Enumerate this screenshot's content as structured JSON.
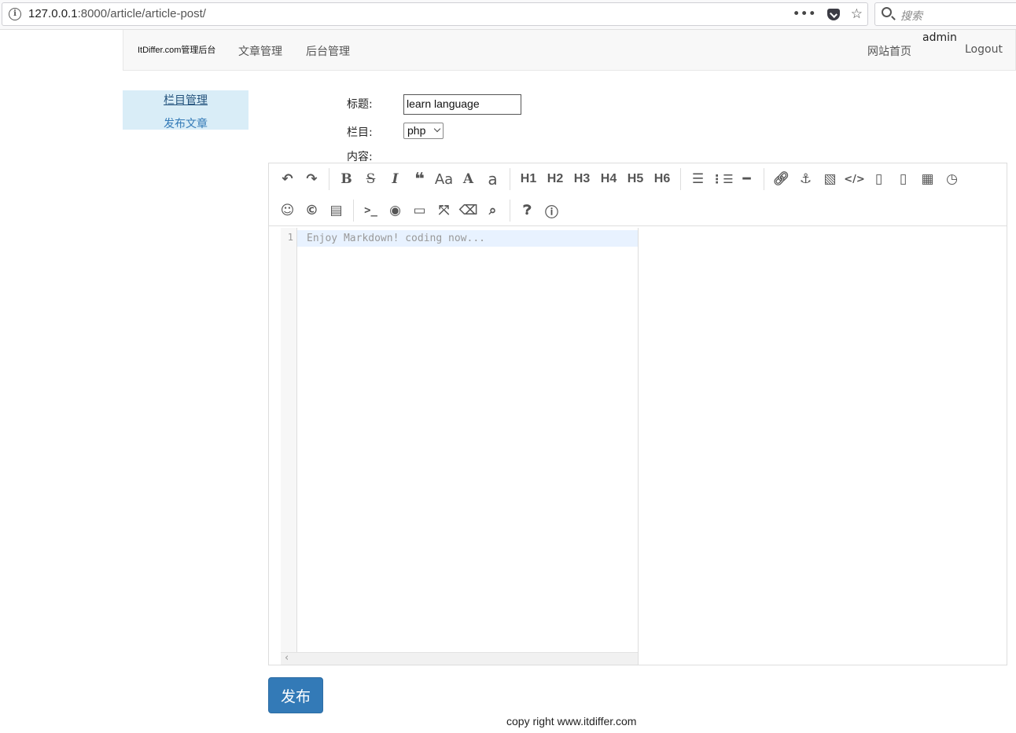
{
  "browser": {
    "url_host": "127.0.0.1",
    "url_rest": ":8000/article/article-post/",
    "search_placeholder": "搜索"
  },
  "navbar": {
    "brand": "ItDiffer.com管理后台",
    "links": [
      "文章管理",
      "后台管理"
    ],
    "home": "网站首页",
    "user": "admin",
    "logout": "Logout"
  },
  "sidebar": {
    "items": [
      "栏目管理",
      "发布文章"
    ]
  },
  "form": {
    "title_label": "标题:",
    "title_value": "learn language",
    "column_label": "栏目:",
    "column_value": "php",
    "content_label": "内容:"
  },
  "editor": {
    "line_number": "1",
    "placeholder": "Enjoy Markdown! coding now...",
    "headings": [
      "H1",
      "H2",
      "H3",
      "H4",
      "H5",
      "H6"
    ]
  },
  "submit_label": "发布",
  "footer": "copy right www.itdiffer.com"
}
